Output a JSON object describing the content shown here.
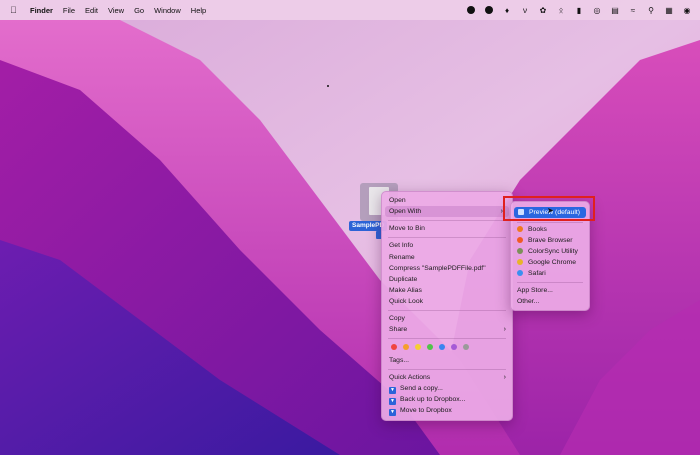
{
  "menubar": {
    "items": [
      "Finder",
      "File",
      "Edit",
      "View",
      "Go",
      "Window",
      "Help"
    ],
    "status_icons": [
      "record-icon",
      "minus-circle-icon",
      "dropbox-icon",
      "v-icon",
      "bug-icon",
      "bluetooth-icon",
      "battery-icon",
      "target-icon",
      "menubar-toggle-icon",
      "wifi-icon",
      "search-icon",
      "control-center-icon",
      "siri-icon"
    ]
  },
  "desktop_file": {
    "label_visible": "SamplePD"
  },
  "context_menu": {
    "open": "Open",
    "open_with": "Open With",
    "move_to_bin": "Move to Bin",
    "get_info": "Get Info",
    "rename": "Rename",
    "compress": "Compress \"SamplePDFFile.pdf\"",
    "duplicate": "Duplicate",
    "make_alias": "Make Alias",
    "quick_look": "Quick Look",
    "copy": "Copy",
    "share": "Share",
    "tags": "Tags...",
    "tag_colors": [
      "#f0453f",
      "#f59f2d",
      "#f5cf33",
      "#52c24a",
      "#3a84f0",
      "#a55ad6",
      "#9a9a9a"
    ],
    "quick_actions": "Quick Actions",
    "send_copy": "Send a copy...",
    "back_up_dropbox": "Back up to Dropbox...",
    "move_to_dropbox": "Move to Dropbox"
  },
  "open_with_submenu": {
    "preview": "Preview (default)",
    "apps": [
      "Books",
      "Brave Browser",
      "ColorSync Utility",
      "Google Chrome",
      "Safari"
    ],
    "app_colors": [
      "#f07a1e",
      "#f15a24",
      "#7d8f5a",
      "#e8b32a",
      "#3a8ff0"
    ],
    "app_store": "App Store...",
    "other": "Other..."
  },
  "colors": {
    "highlight": "#2b66e0",
    "annotation_box": "#e0201e"
  }
}
